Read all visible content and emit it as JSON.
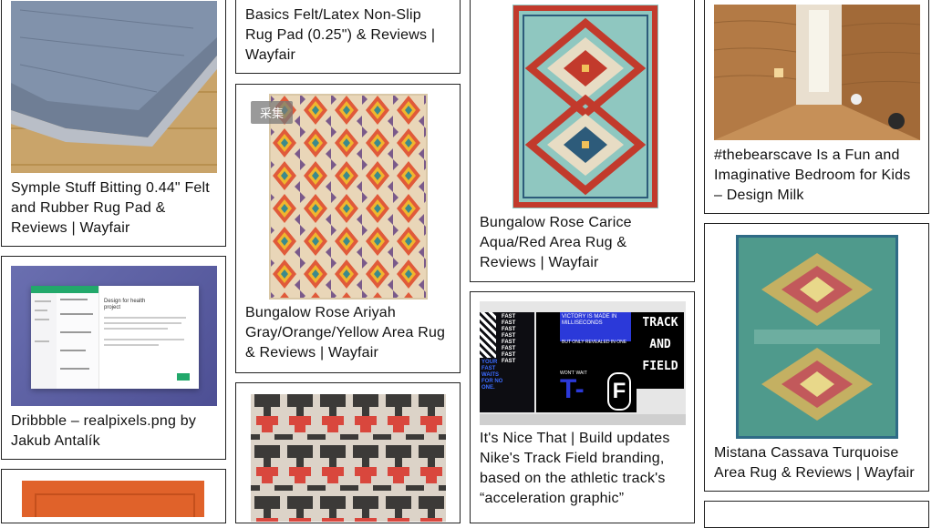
{
  "cards": [
    {
      "id": "c1",
      "caption": "Symple Stuff Bitting 0.44\" Felt and Rubber Rug Pad & Reviews | Wayfair"
    },
    {
      "id": "c2",
      "caption": "Dribbble – realpixels.png by Jakub Antalík"
    },
    {
      "id": "c3",
      "caption": ""
    },
    {
      "id": "c4",
      "caption": "Basics Felt/Latex Non-Slip Rug Pad (0.25\") & Reviews | Wayfair"
    },
    {
      "id": "c5",
      "caption": "Bungalow Rose Ariyah Gray/Orange/Yellow Area Rug & Reviews | Wayfair",
      "tag": "采集"
    },
    {
      "id": "c6",
      "caption": ""
    },
    {
      "id": "c7",
      "caption": "Bungalow Rose Carice Aqua/Red Area Rug & Reviews | Wayfair"
    },
    {
      "id": "c8",
      "caption": "It's Nice That | Build updates Nike's Track Field branding, based on the athletic track's “acceleration graphic”"
    },
    {
      "id": "c9",
      "caption": "#thebearscave Is a Fun and Imaginative Bedroom for Kids – Design Milk"
    },
    {
      "id": "c10",
      "caption": "Mistana Cassava Turquoise Area Rug & Reviews | Wayfair"
    }
  ],
  "nike_poster": {
    "left_words": "FAST FAST FAST FAST FAST FAST FAST FAST",
    "your_fast": "YOUR FAST WAITS FOR NO ONE.",
    "victory": "VICTORY IS MADE IN MILLISECONDS",
    "revealed": "BUT ONLY REVEALED IN ONE",
    "track": "TRACK",
    "and": "AND",
    "field": "FIELD",
    "wont_wait": "WON'T WAIT",
    "t_letter": "T-",
    "f_letter": "F"
  },
  "dribbble_app": {
    "heading": "Design for health project"
  }
}
